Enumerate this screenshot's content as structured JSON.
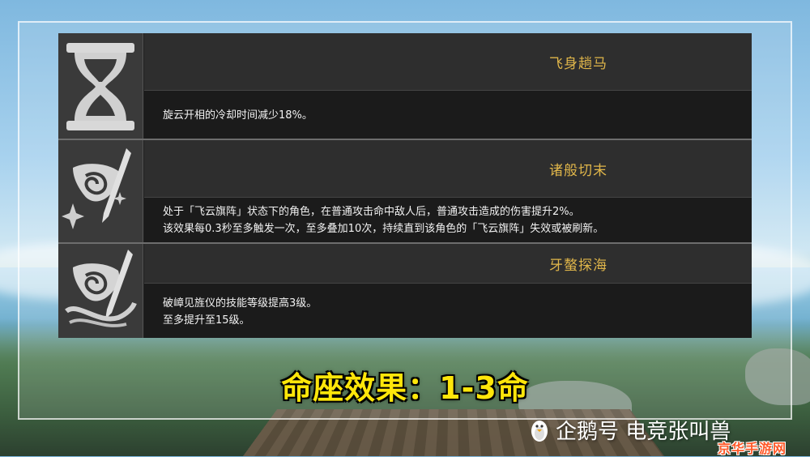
{
  "constellations": [
    {
      "icon": "hourglass-icon",
      "title": "飞身趟马",
      "lines": [
        "旋云开相的冷却时间减少18%。"
      ]
    },
    {
      "icon": "banner-spear-icon",
      "title": "诸般切末",
      "lines": [
        "处于「飞云旗阵」状态下的角色，在普通攻击命中敌人后，普通攻击造成的伤害提升2%。",
        "该效果每0.3秒至多触发一次，至多叠加10次，持续直到该角色的「飞云旗阵」失效或被刷新。"
      ]
    },
    {
      "icon": "banner-swirl-icon",
      "title": "牙螯探海",
      "lines": [
        "破嶂见旌仪的技能等级提高3级。",
        "至多提升至15级。"
      ]
    }
  ],
  "caption": "命座效果：1-3命",
  "watermark": "企鹅号 电竞张叫兽",
  "corner_logo": "京华手游网",
  "colors": {
    "title_gold": "#e0b64a",
    "caption_yellow": "#ffe60a",
    "panel_dark": "#1e1e1e"
  }
}
